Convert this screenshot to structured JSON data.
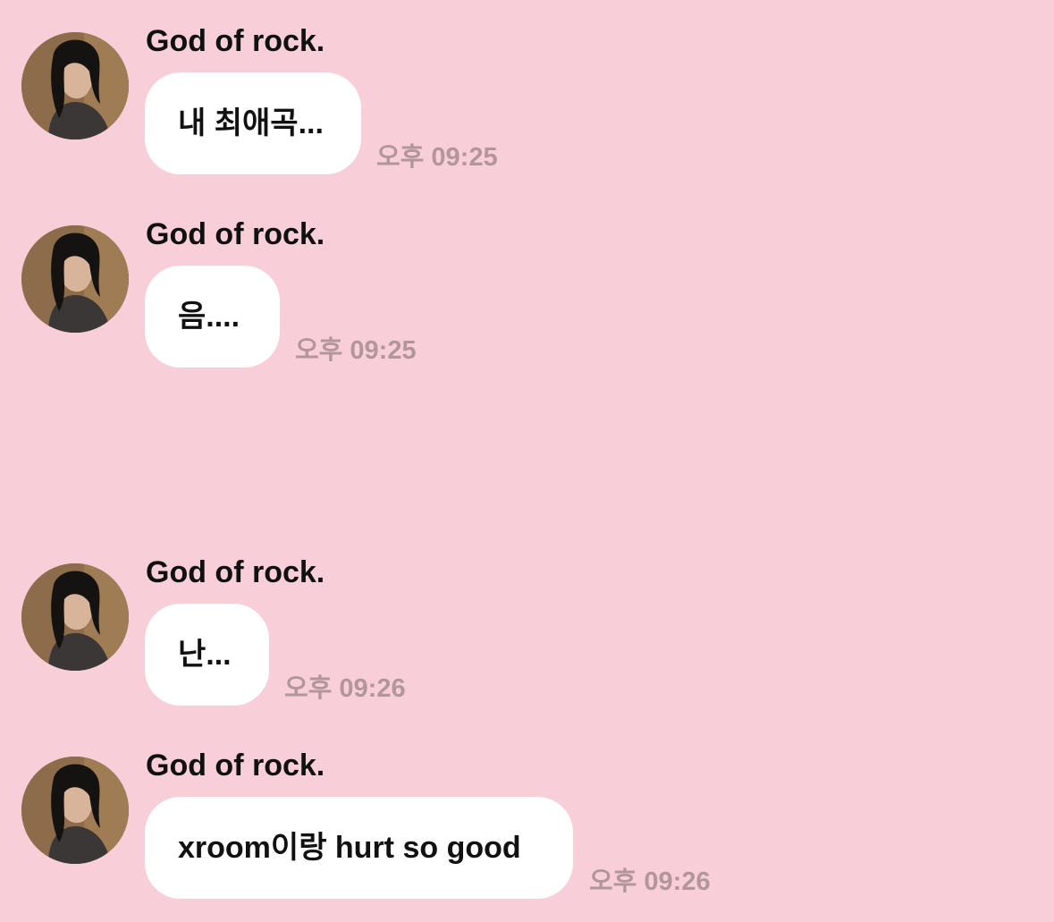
{
  "colors": {
    "background": "#f8cfd9",
    "bubble": "#ffffff",
    "sender_text": "#111111",
    "timestamp_text": "#b3959c"
  },
  "messages": [
    {
      "sender": "God of rock.",
      "text": "내 최애곡...",
      "time": "오후 09:25"
    },
    {
      "sender": "God of rock.",
      "text": "음....",
      "time": "오후 09:25"
    },
    {
      "sender": "God of rock.",
      "text": "난...",
      "time": "오후 09:26"
    },
    {
      "sender": "God of rock.",
      "text": "xroom이랑 hurt so good",
      "time": "오후 09:26"
    }
  ]
}
